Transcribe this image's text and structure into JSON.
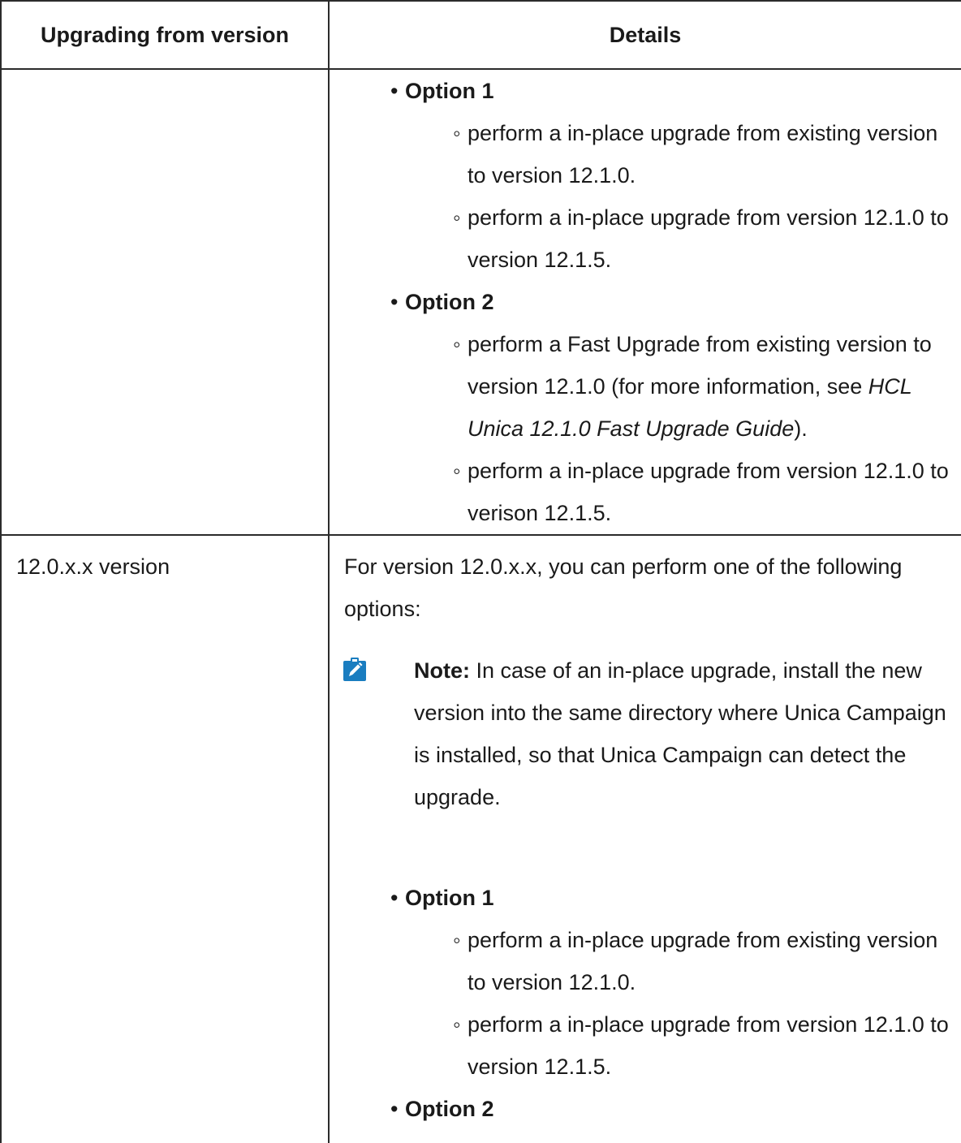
{
  "table": {
    "headers": {
      "col1": "Upgrading from version",
      "col2": "Details"
    },
    "row1": {
      "option1_label": "Option 1",
      "option1_items": [
        "perform a in-place upgrade from existing version to version 12.1.0.",
        "perform a in-place upgrade from version 12.1.0 to version 12.1.5."
      ],
      "option2_label": "Option 2",
      "option2_item1_prefix": "perform a Fast Upgrade from existing version to version 12.1.0 (for more information, see ",
      "option2_item1_ref": "HCL Unica 12.1.0 Fast Upgrade Guide",
      "option2_item1_suffix": ").",
      "option2_item2": "perform a in-place upgrade from version 12.1.0 to verison 12.1.5."
    },
    "row2": {
      "version": "12.0.x.x version",
      "intro": "For version 12.0.x.x, you can perform one of the following options:",
      "note_label": "Note:",
      "note_text": " In case of an in-place upgrade, install the new version into the same directory where Unica Campaign is installed, so that Unica Campaign can detect the upgrade.",
      "option1_label": "Option 1",
      "option1_items": [
        "perform a in-place upgrade from existing version to version 12.1.0.",
        "perform a in-place upgrade from version 12.1.0 to version 12.1.5."
      ],
      "option2_label": "Option 2"
    }
  },
  "icons": {
    "note_icon": "pencil-note-icon",
    "note_icon_color": "#1a7dc0"
  }
}
